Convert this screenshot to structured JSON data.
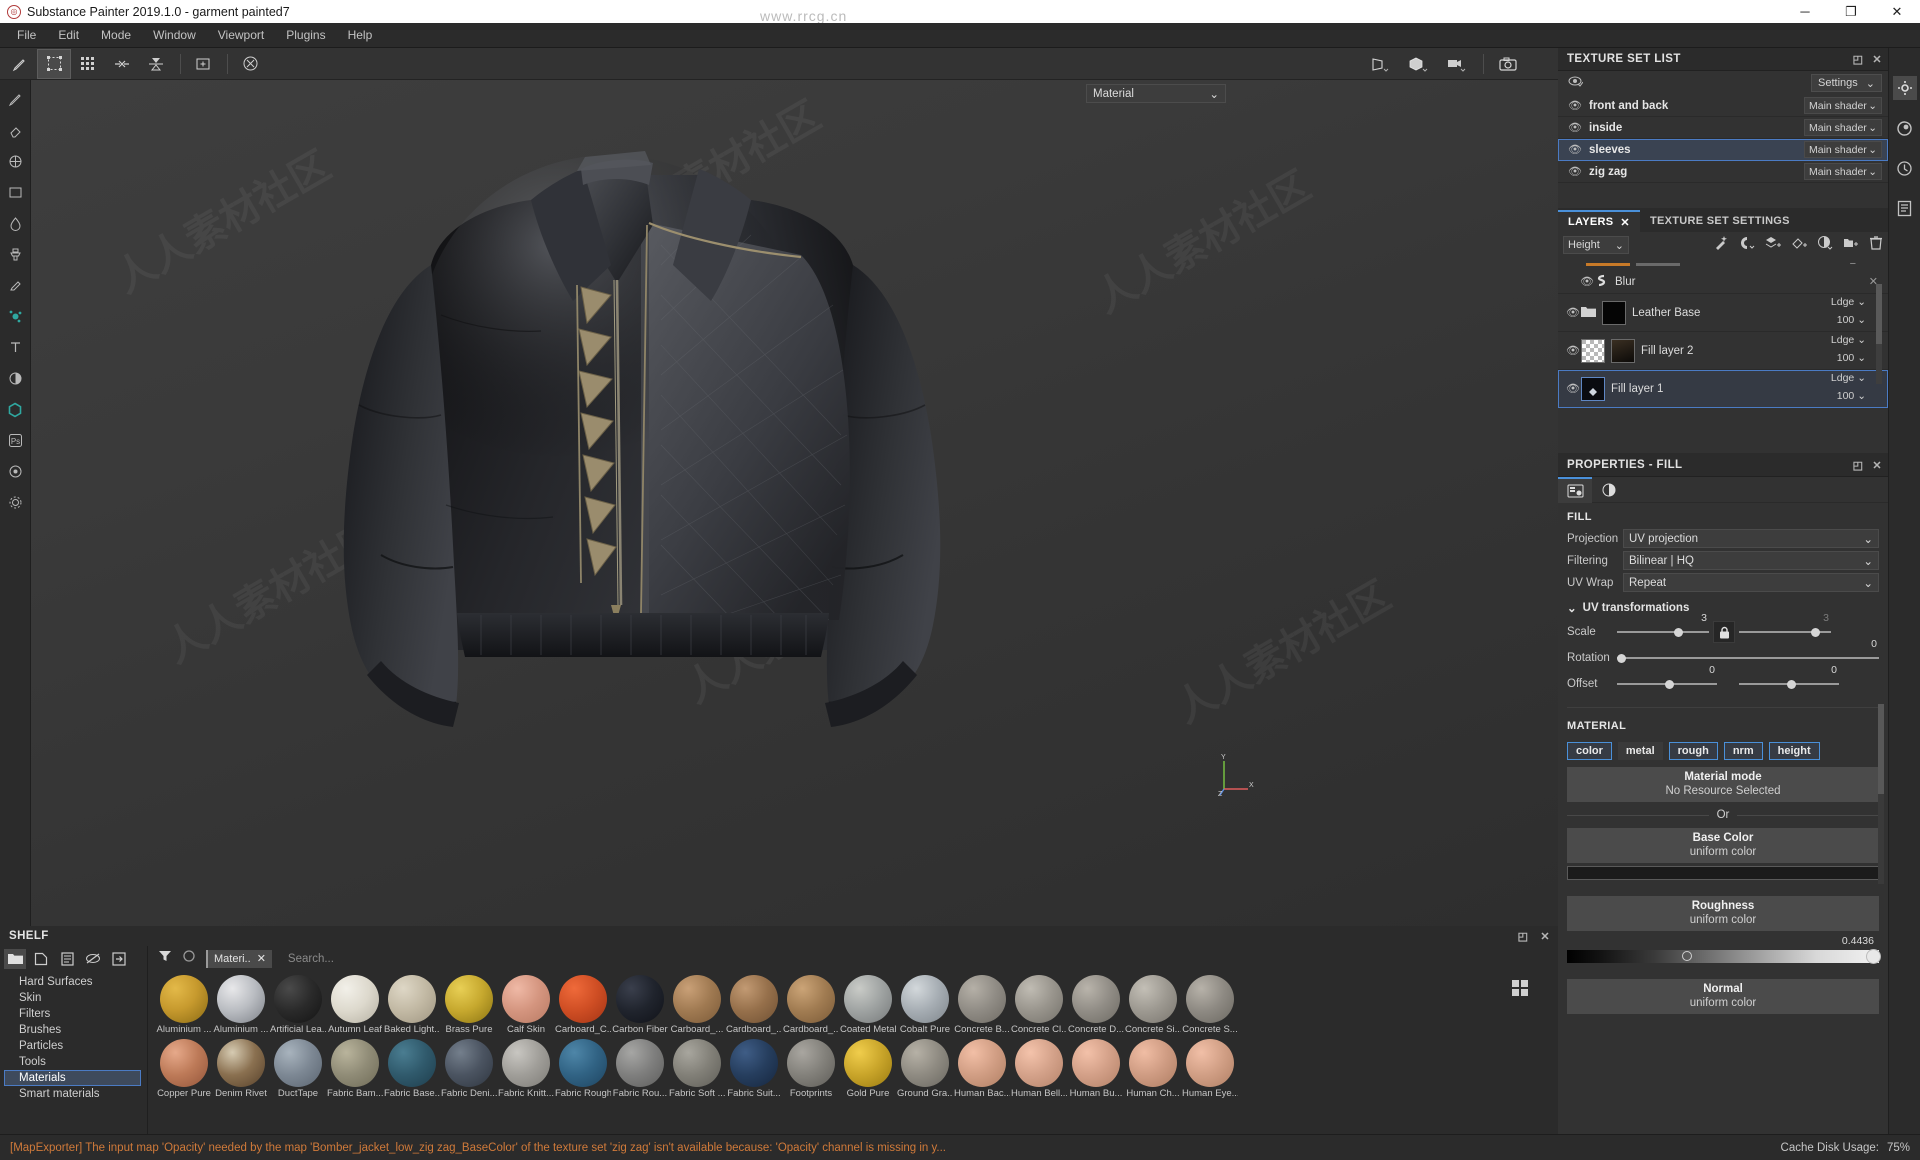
{
  "window": {
    "title": "Substance Painter 2019.1.0 - garment painted7",
    "watermark": "www.rrcg.cn",
    "minimize": "─",
    "maximize": "❐",
    "close": "✕"
  },
  "menu": [
    "File",
    "Edit",
    "Mode",
    "Window",
    "Viewport",
    "Plugins",
    "Help"
  ],
  "viewport": {
    "material_combo": "Material",
    "axis_x": "X",
    "axis_y": "Y",
    "axis_z": "Z"
  },
  "texture_set_list": {
    "title": "TEXTURE SET LIST",
    "settings_label": "Settings",
    "items": [
      {
        "name": "front and back",
        "shader": "Main shader",
        "selected": false
      },
      {
        "name": "inside",
        "shader": "Main shader",
        "selected": false
      },
      {
        "name": "sleeves",
        "shader": "Main shader",
        "selected": true
      },
      {
        "name": "zig zag",
        "shader": "Main shader",
        "selected": false
      }
    ]
  },
  "layers_panel": {
    "tabs": [
      {
        "label": "LAYERS",
        "active": true
      },
      {
        "label": "TEXTURE SET SETTINGS",
        "active": false
      }
    ],
    "channel": "Height",
    "layers": [
      {
        "name": "Blur",
        "type": "effect",
        "blend": "",
        "opacity": "",
        "selected": false
      },
      {
        "name": "Leather Base",
        "type": "folder",
        "blend": "Ldge",
        "opacity": "100",
        "selected": false
      },
      {
        "name": "Fill layer 2",
        "type": "fill",
        "blend": "Ldge",
        "opacity": "100",
        "selected": false
      },
      {
        "name": "Fill layer 1",
        "type": "fill",
        "blend": "Ldge",
        "opacity": "100",
        "selected": true
      }
    ]
  },
  "properties": {
    "title": "PROPERTIES - FILL",
    "section_fill": "FILL",
    "projection_label": "Projection",
    "projection_value": "UV projection",
    "filtering_label": "Filtering",
    "filtering_value": "Bilinear | HQ",
    "uvwrap_label": "UV Wrap",
    "uvwrap_value": "Repeat",
    "uv_transformations": "UV transformations",
    "scale_label": "Scale",
    "scale_u": "3",
    "scale_v": "3",
    "rotation_label": "Rotation",
    "rotation_value": "0",
    "offset_label": "Offset",
    "offset_u": "0",
    "offset_v": "0",
    "section_material": "MATERIAL",
    "channels": [
      {
        "label": "color",
        "on": true
      },
      {
        "label": "metal",
        "on": false
      },
      {
        "label": "rough",
        "on": true
      },
      {
        "label": "nrm",
        "on": true
      },
      {
        "label": "height",
        "on": true
      }
    ],
    "material_mode_title": "Material mode",
    "material_mode_value": "No Resource Selected",
    "or_label": "Or",
    "base_color_title": "Base Color",
    "base_color_value": "uniform color",
    "base_color_hex": "#1b1b1b",
    "roughness_title": "Roughness",
    "roughness_value": "uniform color",
    "roughness_number": "0.4436",
    "normal_title": "Normal",
    "normal_value": "uniform color"
  },
  "shelf": {
    "title": "SHELF",
    "categories": [
      {
        "label": "Hard Surfaces",
        "selected": false
      },
      {
        "label": "Skin",
        "selected": false
      },
      {
        "label": "Filters",
        "selected": false
      },
      {
        "label": "Brushes",
        "selected": false
      },
      {
        "label": "Particles",
        "selected": false
      },
      {
        "label": "Tools",
        "selected": false
      },
      {
        "label": "Materials",
        "selected": true
      },
      {
        "label": "Smart materials",
        "selected": false
      }
    ],
    "filter_tag": "Materi..",
    "search_placeholder": "Search...",
    "items_row1": [
      {
        "name": "Aluminium ...",
        "color1": "#e3b949",
        "color2": "#8a6a14"
      },
      {
        "name": "Aluminium ...",
        "color1": "#e8e8ea",
        "color2": "#7c8087"
      },
      {
        "name": "Artificial Lea...",
        "color1": "#4a4a4a",
        "color2": "#141414"
      },
      {
        "name": "Autumn Leaf",
        "color1": "#eceae2",
        "color2": "#b5b0a2"
      },
      {
        "name": "Baked Light...",
        "color1": "#ded7c6",
        "color2": "#9e9581"
      },
      {
        "name": "Brass Pure",
        "color1": "#e8cf55",
        "color2": "#8a7312"
      },
      {
        "name": "Calf Skin",
        "color1": "#efb9a6",
        "color2": "#b87a63"
      },
      {
        "name": "Carboard_C...",
        "color1": "#ef6a3a",
        "color2": "#a33415"
      },
      {
        "name": "Carbon Fiber",
        "color1": "#3a3f4c",
        "color2": "#101218"
      },
      {
        "name": "Carboard_...",
        "color1": "#c9a077",
        "color2": "#7b5a38"
      },
      {
        "name": "Cardboard_...",
        "color1": "#c29a73",
        "color2": "#6f5033"
      },
      {
        "name": "Cardboard_...",
        "color1": "#cba477",
        "color2": "#7a5a37"
      },
      {
        "name": "Coated Metal",
        "color1": "#c9cbc7",
        "color2": "#76797a"
      },
      {
        "name": "Cobalt Pure",
        "color1": "#d3d8db",
        "color2": "#7e858b"
      },
      {
        "name": "Concrete B...",
        "color1": "#b5b0a7",
        "color2": "#6e6a63"
      },
      {
        "name": "Concrete Cl...",
        "color1": "#c0bcb3",
        "color2": "#74716a"
      },
      {
        "name": "Concrete D...",
        "color1": "#b9b4ab",
        "color2": "#6d6a63"
      },
      {
        "name": "Concrete Si...",
        "color1": "#c3bfb6",
        "color2": "#79756e"
      },
      {
        "name": "Concrete S...",
        "color1": "#b7b2a9",
        "color2": "#6b6861"
      }
    ],
    "items_row2": [
      {
        "name": "Copper Pure",
        "color1": "#e6a98a",
        "color2": "#93553a"
      },
      {
        "name": "Denim Rivet",
        "color1": "#d6cbb2",
        "color2": "#56402a"
      },
      {
        "name": "DuctTape",
        "color1": "#a8b3bd",
        "color2": "#5a6470"
      },
      {
        "name": "Fabric Bam...",
        "color1": "#b9b49c",
        "color2": "#6f6b57"
      },
      {
        "name": "Fabric Base...",
        "color1": "#4a7d91",
        "color2": "#1e3d4c"
      },
      {
        "name": "Fabric Deni...",
        "color1": "#747f8c",
        "color2": "#2f3640"
      },
      {
        "name": "Fabric Knitt...",
        "color1": "#c8c6c1",
        "color2": "#7d7b76"
      },
      {
        "name": "Fabric Rough",
        "color1": "#4e86a8",
        "color2": "#1e4460"
      },
      {
        "name": "Fabric Rou...",
        "color1": "#a6a6a4",
        "color2": "#5d5d5c"
      },
      {
        "name": "Fabric Soft ...",
        "color1": "#a8a69e",
        "color2": "#5f5e58"
      },
      {
        "name": "Fabric Suit...",
        "color1": "#3f5d86",
        "color2": "#16263e"
      },
      {
        "name": "Footprints",
        "color1": "#a9a6a0",
        "color2": "#5e5c57"
      },
      {
        "name": "Gold Pure",
        "color1": "#f0cd4c",
        "color2": "#9a7a10"
      },
      {
        "name": "Ground Gra...",
        "color1": "#b6b1a6",
        "color2": "#6a6760"
      },
      {
        "name": "Human Bac...",
        "color1": "#f2bfa6",
        "color2": "#b07f63"
      },
      {
        "name": "Human Bell...",
        "color1": "#f4c3ab",
        "color2": "#b5836a"
      },
      {
        "name": "Human Bu...",
        "color1": "#f3c1a9",
        "color2": "#b38167"
      },
      {
        "name": "Human Ch...",
        "color1": "#f0bda4",
        "color2": "#ae7d62"
      },
      {
        "name": "Human Eye...",
        "color1": "#f1bfa7",
        "color2": "#b07f64"
      }
    ]
  },
  "statusbar": {
    "message": "[MapExporter] The input map 'Opacity' needed by the map 'Bomber_jacket_low_zig zag_BaseColor' of the texture set 'zig zag' isn't available because: 'Opacity' channel is missing in y...",
    "cache_label": "Cache Disk Usage:",
    "cache_value": "75%"
  }
}
